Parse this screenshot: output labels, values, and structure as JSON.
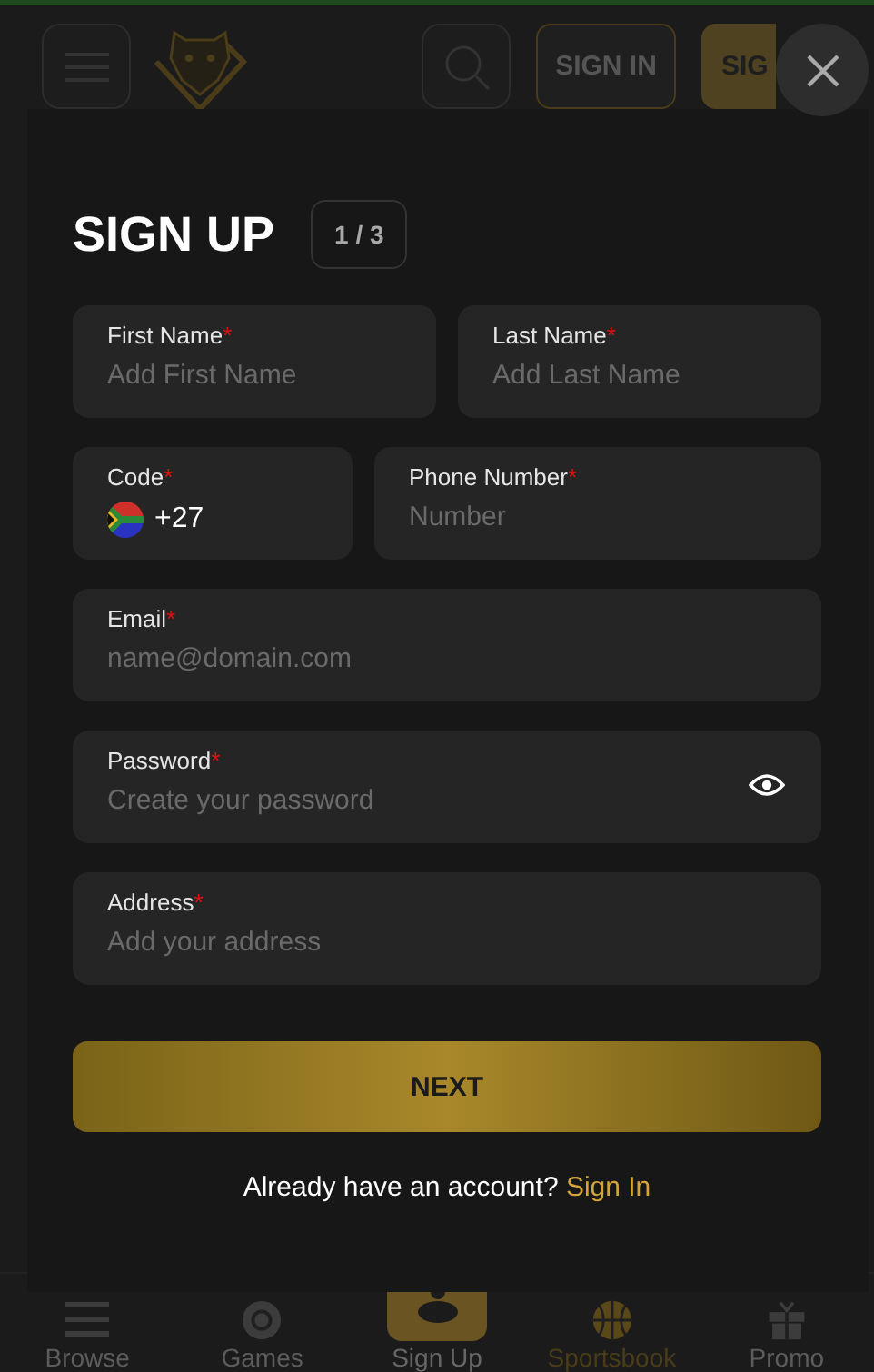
{
  "header": {
    "sign_in": "SIGN IN",
    "sign_up": "SIG"
  },
  "modal": {
    "title": "SIGN UP",
    "step": "1 / 3",
    "field_rows": [
      [
        {
          "kind": "text",
          "label": "First Name",
          "required_mark": "*",
          "placeholder": "Add First Name"
        },
        {
          "kind": "text",
          "label": "Last Name",
          "required_mark": "*",
          "placeholder": "Add Last Name"
        }
      ],
      [
        {
          "kind": "code",
          "label": "Code",
          "required_mark": "*",
          "value": "+27"
        },
        {
          "kind": "text",
          "label": "Phone Number",
          "required_mark": "*",
          "placeholder": "Number"
        }
      ],
      [
        {
          "kind": "text",
          "label": "Email",
          "required_mark": "*",
          "placeholder": "name@domain.com"
        }
      ],
      [
        {
          "kind": "password",
          "label": "Password",
          "required_mark": "*",
          "placeholder": "Create your password"
        }
      ],
      [
        {
          "kind": "text",
          "label": "Address",
          "required_mark": "*",
          "placeholder": "Add your address"
        }
      ]
    ],
    "next_button": "NEXT",
    "account_prompt": "Already have an account?",
    "sign_in_link": "Sign In"
  },
  "bottom_nav": [
    {
      "kind": "menu",
      "label": "Browse",
      "selected": false
    },
    {
      "kind": "chip",
      "label": "Games",
      "selected": false
    },
    {
      "kind": "user",
      "label": "Sign Up",
      "selected": true
    },
    {
      "kind": "ball",
      "label": "Sportsbook",
      "selected": false
    },
    {
      "kind": "gift",
      "label": "Promo",
      "selected": false
    }
  ]
}
